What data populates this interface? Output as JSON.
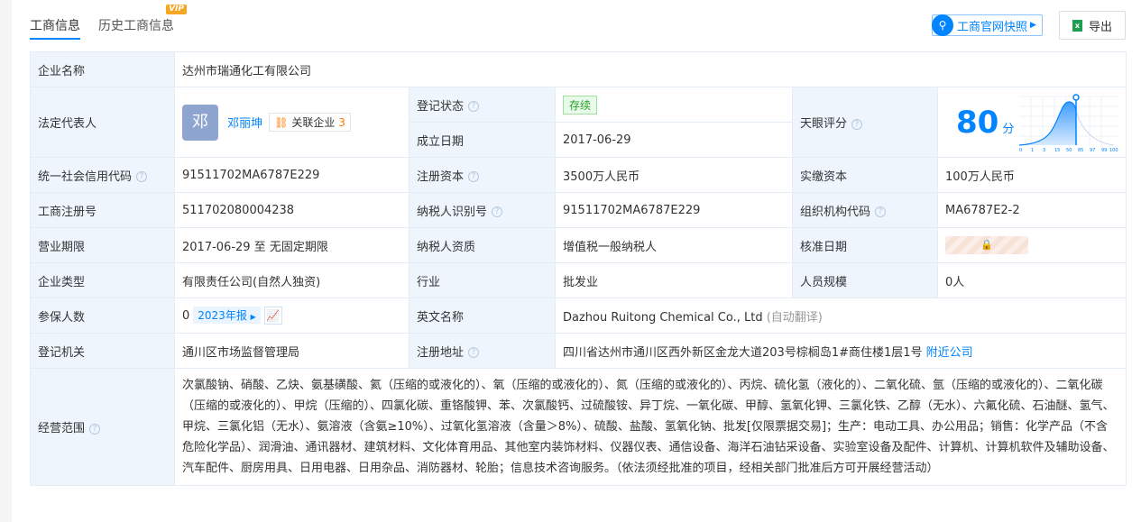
{
  "tabs": [
    {
      "label": "工商信息",
      "active": true
    },
    {
      "label": "历史工商信息",
      "badge": "VIP"
    }
  ],
  "toolbar": {
    "snapshot": "工商官网快照",
    "export": "导出"
  },
  "rows": {
    "company_name": {
      "label": "企业名称",
      "value": "达州市瑞通化工有限公司"
    },
    "legal_rep": {
      "label": "法定代表人",
      "avatar": "邓",
      "name": "邓丽坤",
      "related_label": "关联企业",
      "related_count": "3"
    },
    "reg_status": {
      "label": "登记状态",
      "value": "存续"
    },
    "founded": {
      "label": "成立日期",
      "value": "2017-06-29"
    },
    "score": {
      "label": "天眼评分",
      "value": "80",
      "unit": "分",
      "axis": [
        "0",
        "1",
        "3",
        "15",
        "50",
        "85",
        "97",
        "99",
        "100"
      ]
    },
    "credit_code": {
      "label": "统一社会信用代码",
      "value": "91511702MA6787E229"
    },
    "reg_capital": {
      "label": "注册资本",
      "value": "3500万人民币"
    },
    "paid_capital": {
      "label": "实缴资本",
      "value": "100万人民币"
    },
    "reg_no": {
      "label": "工商注册号",
      "value": "511702080004238"
    },
    "taxpayer_id": {
      "label": "纳税人识别号",
      "value": "91511702MA6787E229"
    },
    "org_code": {
      "label": "组织机构代码",
      "value": "MA6787E2-2"
    },
    "term": {
      "label": "营业期限",
      "value": "2017-06-29 至 无固定期限"
    },
    "taxpayer_type": {
      "label": "纳税人资质",
      "value": "增值税一般纳税人"
    },
    "approved_date": {
      "label": "核准日期"
    },
    "company_type": {
      "label": "企业类型",
      "value": "有限责任公司(自然人独资)"
    },
    "industry": {
      "label": "行业",
      "value": "批发业"
    },
    "staff": {
      "label": "人员规模",
      "value": "0人"
    },
    "insured": {
      "label": "参保人数",
      "value": "0",
      "report": "2023年报"
    },
    "english": {
      "label": "英文名称",
      "value": "Dazhou Ruitong Chemical Co., Ltd",
      "note": "(自动翻译)"
    },
    "authority": {
      "label": "登记机关",
      "value": "通川区市场监督管理局"
    },
    "address": {
      "label": "注册地址",
      "value": "四川省达州市通川区西外新区金龙大道203号棕榈岛1#商住楼1层1号",
      "nearby": "附近公司"
    },
    "scope": {
      "label": "经营范围",
      "value": "次氯酸钠、硝酸、乙炔、氨基磺酸、氦（压缩的或液化的）、氧（压缩的或液化的）、氮（压缩的或液化的）、丙烷、硫化氢（液化的）、二氧化硫、氩（压缩的或液化的）、二氧化碳（压缩的或液化的）、甲烷（压缩的）、四氯化碳、重铬酸钾、苯、次氯酸钙、过硫酸铵、异丁烷、一氧化碳、甲醇、氢氧化钾、三氯化铁、乙醇（无水）、六氟化硫、石油醚、氢气、甲烷、三氯化铝（无水）、氨溶液（含氨≥10%）、过氧化氢溶液（含量＞8%）、硫酸、盐酸、氢氧化钠、批发[仅限票据交易]；生产：电动工具、办公用品；销售：化学产品（不含危险化学品）、润滑油、通讯器材、建筑材料、文化体育用品、其他室内装饰材料、仪器仪表、通信设备、海洋石油钻采设备、实验室设备及配件、计算机、计算机软件及辅助设备、汽车配件、厨房用具、日用电器、日用杂品、消防器材、轮胎；信息技术咨询服务。（依法须经批准的项目，经相关部门批准后方可开展经营活动）"
    }
  }
}
